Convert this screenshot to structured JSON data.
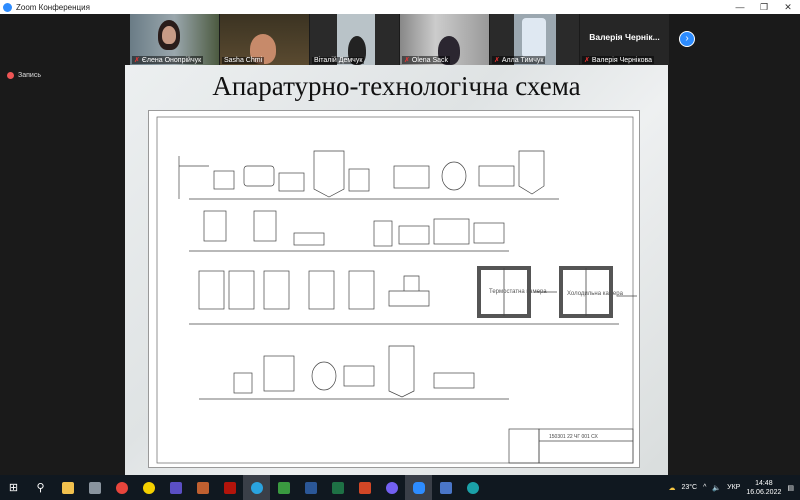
{
  "window": {
    "title": "Zoom Конференция",
    "minimize": "—",
    "restore": "❐",
    "close": "✕"
  },
  "participants": [
    {
      "name": "Єлена Онопрійчук",
      "muted": true
    },
    {
      "name": "Sasha Chmi",
      "muted": false
    },
    {
      "name": "Віталій Демчук",
      "muted": false
    },
    {
      "name": "Olena Sack",
      "muted": true
    },
    {
      "name": "Алла Тимчук",
      "muted": true
    },
    {
      "name": "Валерія Чернікова",
      "display": "Валерія Чернік...",
      "muted": true
    }
  ],
  "gallery_next": "›",
  "recording": {
    "label": "Запись"
  },
  "slide": {
    "title": "Апаратурно-технологічна схема",
    "drawing": {
      "code": "150301 22 ЧГ 001 СХ",
      "chamber1": "Термостатна камера",
      "chamber2": "Холодильна камера"
    }
  },
  "taskbar": {
    "weather": "23°C",
    "lang": "УКР",
    "time": "14:48",
    "date": "16.06.2022",
    "icons": [
      "windows-start",
      "search",
      "file-explorer",
      "calculator",
      "chrome",
      "app-yellow",
      "save-app",
      "app-shield",
      "acrobat",
      "telegram",
      "app-green",
      "word",
      "excel",
      "powerpoint",
      "viber",
      "zoom",
      "app-network",
      "edge"
    ]
  }
}
